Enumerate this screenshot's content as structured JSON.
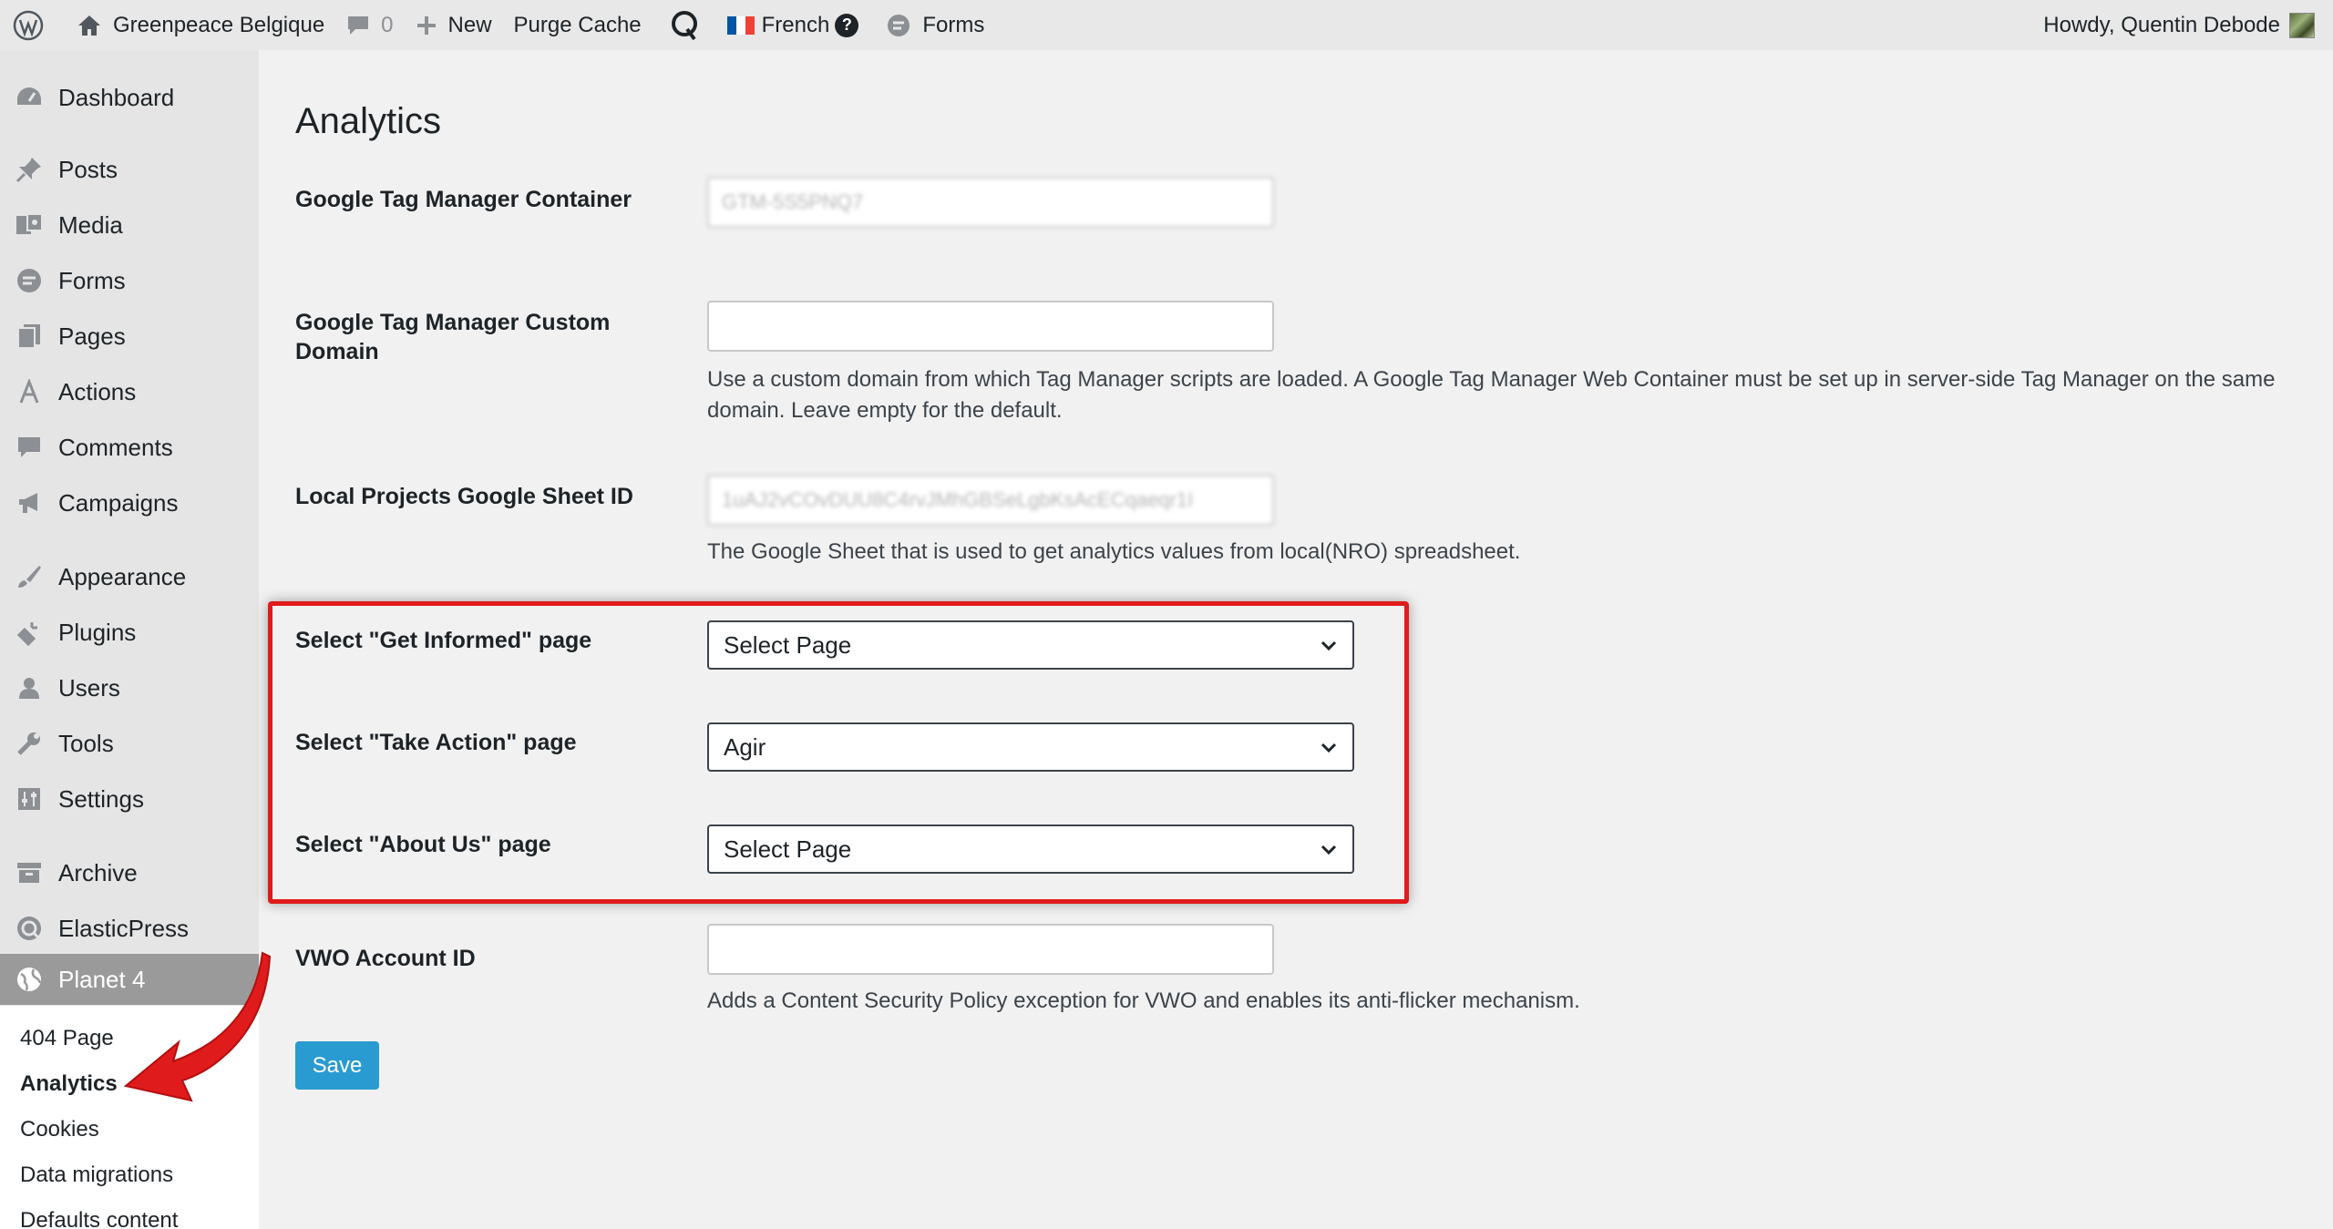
{
  "admin_bar": {
    "site_name": "Greenpeace Belgique",
    "comments_count": "0",
    "new_label": "New",
    "purge_cache": "Purge Cache",
    "language": "French",
    "forms": "Forms",
    "howdy": "Howdy, Quentin Debode"
  },
  "sidebar": {
    "items": [
      {
        "label": "Dashboard",
        "icon": "dashboard-icon"
      },
      {
        "label": "Posts",
        "icon": "pin-icon"
      },
      {
        "label": "Media",
        "icon": "media-icon"
      },
      {
        "label": "Forms",
        "icon": "forms-icon"
      },
      {
        "label": "Pages",
        "icon": "pages-icon"
      },
      {
        "label": "Actions",
        "icon": "actions-icon"
      },
      {
        "label": "Comments",
        "icon": "comment-icon"
      },
      {
        "label": "Campaigns",
        "icon": "megaphone-icon"
      },
      {
        "label": "Appearance",
        "icon": "brush-icon"
      },
      {
        "label": "Plugins",
        "icon": "plug-icon"
      },
      {
        "label": "Users",
        "icon": "user-icon"
      },
      {
        "label": "Tools",
        "icon": "wrench-icon"
      },
      {
        "label": "Settings",
        "icon": "sliders-icon"
      },
      {
        "label": "Archive",
        "icon": "archive-icon"
      },
      {
        "label": "ElasticPress",
        "icon": "elasticpress-icon"
      },
      {
        "label": "Planet 4",
        "icon": "globe-icon"
      }
    ],
    "submenu": [
      "404 Page",
      "Analytics",
      "Cookies",
      "Data migrations",
      "Defaults content"
    ]
  },
  "page": {
    "title": "Analytics",
    "gtm_container_label": "Google Tag Manager Container",
    "gtm_container_value": "GTM-5S5PNQ7",
    "gtm_domain_label": "Google Tag Manager Custom Domain",
    "gtm_domain_value": "",
    "gtm_domain_desc": "Use a custom domain from which Tag Manager scripts are loaded. A Google Tag Manager Web Container must be set up in server-side Tag Manager on the same domain. Leave empty for the default.",
    "sheet_label": "Local Projects Google Sheet ID",
    "sheet_value": "1uAJ2vCOvDUU8C4rvJMhGBSeLgbKsAcECqaeqr1I",
    "sheet_desc": "The Google Sheet that is used to get analytics values from local(NRO) spreadsheet.",
    "get_informed_label": "Select \"Get Informed\" page",
    "get_informed_value": "Select Page",
    "take_action_label": "Select \"Take Action\" page",
    "take_action_value": "Agir",
    "about_us_label": "Select \"About Us\" page",
    "about_us_value": "Select Page",
    "vwo_label": "VWO Account ID",
    "vwo_value": "",
    "vwo_desc": "Adds a Content Security Policy exception for VWO and enables its anti-flicker mechanism.",
    "save_label": "Save"
  },
  "colors": {
    "highlight": "#e01b1b",
    "save_button": "#2a9bd1",
    "admin_bar_bg": "#e8e8e8",
    "sidebar_bg": "#e5e5e5",
    "current_menu_bg": "#9a9a9a"
  }
}
